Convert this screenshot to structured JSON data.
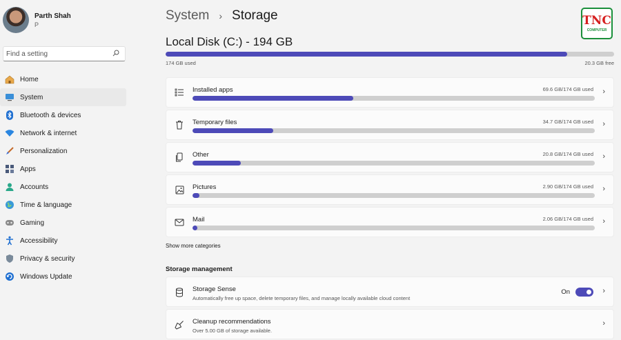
{
  "profile": {
    "name": "Parth Shah",
    "subtitle": "P"
  },
  "search": {
    "placeholder": "Find a setting"
  },
  "nav": [
    {
      "label": "Home",
      "icon": "home-icon"
    },
    {
      "label": "System",
      "icon": "monitor-icon",
      "active": true
    },
    {
      "label": "Bluetooth & devices",
      "icon": "bluetooth-icon"
    },
    {
      "label": "Network & internet",
      "icon": "wifi-icon"
    },
    {
      "label": "Personalization",
      "icon": "brush-icon"
    },
    {
      "label": "Apps",
      "icon": "apps-icon"
    },
    {
      "label": "Accounts",
      "icon": "person-icon"
    },
    {
      "label": "Time & language",
      "icon": "globe-icon"
    },
    {
      "label": "Gaming",
      "icon": "gamepad-icon"
    },
    {
      "label": "Accessibility",
      "icon": "accessibility-icon"
    },
    {
      "label": "Privacy & security",
      "icon": "shield-icon"
    },
    {
      "label": "Windows Update",
      "icon": "update-icon"
    }
  ],
  "breadcrumb": {
    "parent": "System",
    "separator": "›",
    "current": "Storage"
  },
  "logo": {
    "main": "TNC",
    "sub": "COMPUTER"
  },
  "disk": {
    "title": "Local Disk (C:) - 194 GB",
    "used_label": "174 GB used",
    "free_label": "20.3 GB free",
    "used_fraction": 0.895
  },
  "categories": [
    {
      "name": "Installed apps",
      "size": "69.6 GB/174 GB used",
      "fraction": 0.4,
      "icon": "list-icon"
    },
    {
      "name": "Temporary files",
      "size": "34.7 GB/174 GB used",
      "fraction": 0.2,
      "icon": "trash-icon"
    },
    {
      "name": "Other",
      "size": "20.8 GB/174 GB used",
      "fraction": 0.12,
      "icon": "document-icon"
    },
    {
      "name": "Pictures",
      "size": "2.90 GB/174 GB used",
      "fraction": 0.017,
      "icon": "picture-icon"
    },
    {
      "name": "Mail",
      "size": "2.06 GB/174 GB used",
      "fraction": 0.012,
      "icon": "mail-icon"
    }
  ],
  "show_more": "Show more categories",
  "storage_management": {
    "heading": "Storage management",
    "storage_sense": {
      "title": "Storage Sense",
      "description": "Automatically free up space, delete temporary files, and manage locally available cloud content",
      "toggle_label": "On",
      "toggle_on": true
    },
    "cleanup": {
      "title": "Cleanup recommendations",
      "description": "Over 5.00 GB of storage available."
    }
  },
  "colors": {
    "accent": "#4d4ab8",
    "track": "#cfcfcf",
    "background": "#f3f3f3",
    "card": "#fbfbfb"
  }
}
